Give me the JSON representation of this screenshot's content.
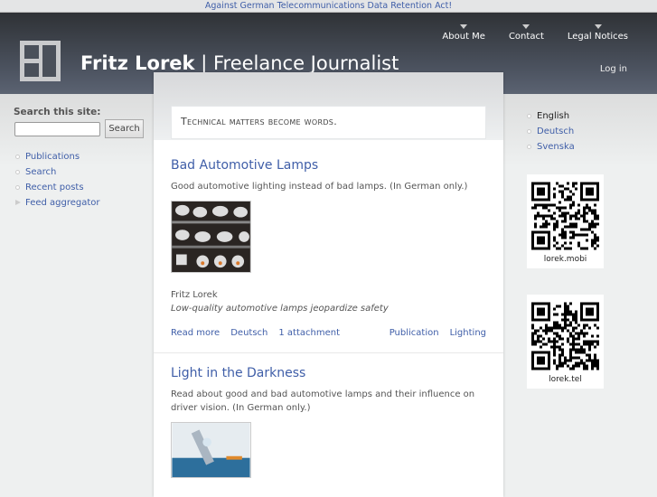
{
  "topbar": {
    "link": "Against German Telecommunications Data Retention Act!"
  },
  "header": {
    "name": "Fritz Lorek",
    "separator": "|",
    "subtitle": "Freelance Journalist",
    "nav": [
      "About Me",
      "Contact",
      "Legal Notices"
    ],
    "login": "Log in"
  },
  "tagline": "Technical matters become words.",
  "search": {
    "label": "Search this site:",
    "value": "",
    "button": "Search"
  },
  "leftmenu": [
    "Publications",
    "Search",
    "Recent posts",
    "Feed aggregator"
  ],
  "languages": {
    "current": "English",
    "others": [
      "Deutsch",
      "Svenska"
    ]
  },
  "qr": [
    {
      "caption": "lorek.mobi"
    },
    {
      "caption": "lorek.tel"
    }
  ],
  "posts": [
    {
      "title": "Bad Automotive Lamps",
      "desc": "Good automotive lighting instead of bad lamps. (In German only.)",
      "author": "Fritz Lorek",
      "subtitle": "Low-quality automotive lamps jeopardize safety",
      "links": {
        "read_more": "Read more",
        "lang": "Deutsch",
        "attachment": "1 attachment",
        "type": "Publication",
        "tag": "Lighting"
      }
    },
    {
      "title": "Light in the Darkness",
      "desc": "Read about good and bad automotive lamps and their influence on driver vision. (In German only.)"
    }
  ],
  "colors": {
    "link": "#3f5ea8",
    "header": "#3f454f"
  }
}
